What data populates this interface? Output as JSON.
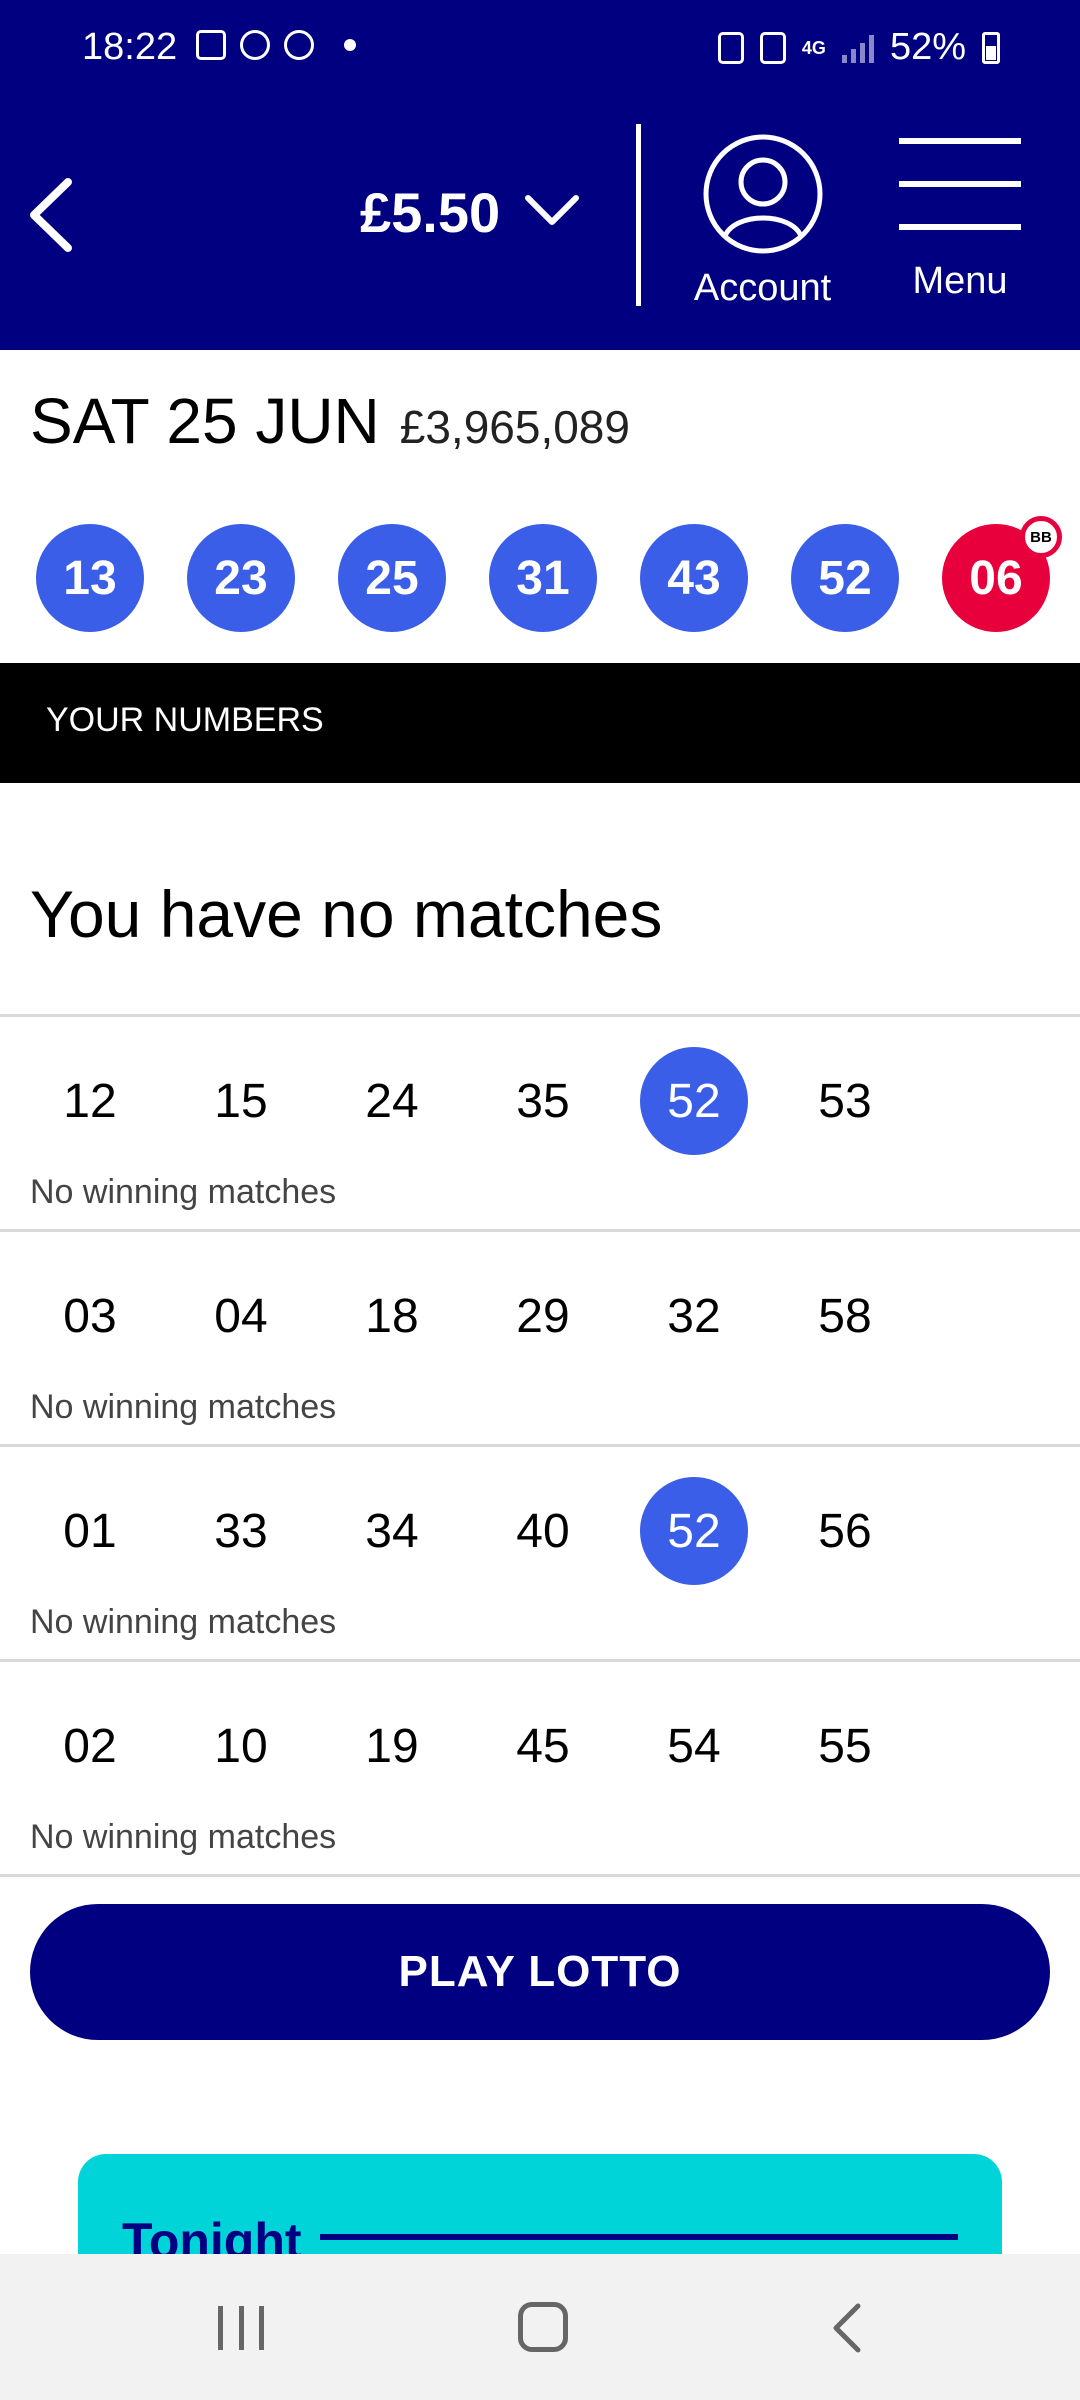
{
  "status_bar": {
    "time": "18:22",
    "network": "4G",
    "battery": "52%"
  },
  "header": {
    "balance": "£5.50",
    "account_label": "Account",
    "menu_label": "Menu"
  },
  "draw": {
    "date": "SAT 25 JUN",
    "jackpot": "£3,965,089",
    "balls": [
      "13",
      "23",
      "25",
      "31",
      "43",
      "52"
    ],
    "bonus_ball": "06",
    "bonus_badge": "BB"
  },
  "section_title": "YOUR NUMBERS",
  "result_heading": "You have no matches",
  "lines": [
    {
      "numbers": [
        "12",
        "15",
        "24",
        "35",
        "52",
        "53"
      ],
      "matched": [
        "52"
      ],
      "status": "No winning matches"
    },
    {
      "numbers": [
        "03",
        "04",
        "18",
        "29",
        "32",
        "58"
      ],
      "matched": [],
      "status": "No winning matches"
    },
    {
      "numbers": [
        "01",
        "33",
        "34",
        "40",
        "52",
        "56"
      ],
      "matched": [
        "52"
      ],
      "status": "No winning matches"
    },
    {
      "numbers": [
        "02",
        "10",
        "19",
        "45",
        "54",
        "55"
      ],
      "matched": [],
      "status": "No winning matches"
    }
  ],
  "play_button": "PLAY LOTTO",
  "promo": {
    "title": "Tonight"
  },
  "colors": {
    "header_bg": "#000080",
    "ball": "#3a5ee8",
    "bonus_ball": "#e8003c",
    "promo_bg": "#00d4d8"
  }
}
